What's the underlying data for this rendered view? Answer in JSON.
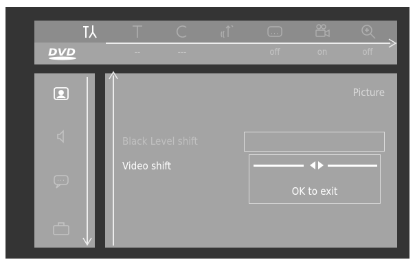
{
  "topbar": {
    "icons": [
      "settings-tools-icon",
      "text-t-icon",
      "c-icon",
      "audio-icon",
      "subtitle-icon",
      "camera-angle-icon",
      "zoom-icon"
    ]
  },
  "statusbar": {
    "logo": "DVD",
    "values": [
      "--",
      "---",
      "off",
      "on",
      "off"
    ]
  },
  "sidebar": {
    "icons": [
      "picture-icon",
      "speaker-icon",
      "speech-bubble-icon",
      "briefcase-icon"
    ],
    "selected": "picture-icon"
  },
  "panel": {
    "title": "Picture",
    "rows": [
      {
        "label": "Black Level shift",
        "state": "inactive"
      },
      {
        "label": "Video shift",
        "state": "active"
      }
    ],
    "popup": {
      "hint": "OK to exit"
    }
  },
  "colors": {
    "screen_bg": "#343434",
    "panel_bg": "#a4a4a4",
    "topbar_bg": "#8c8c8c",
    "active_text": "#ffffff",
    "inactive_text": "#c0c0c0"
  }
}
